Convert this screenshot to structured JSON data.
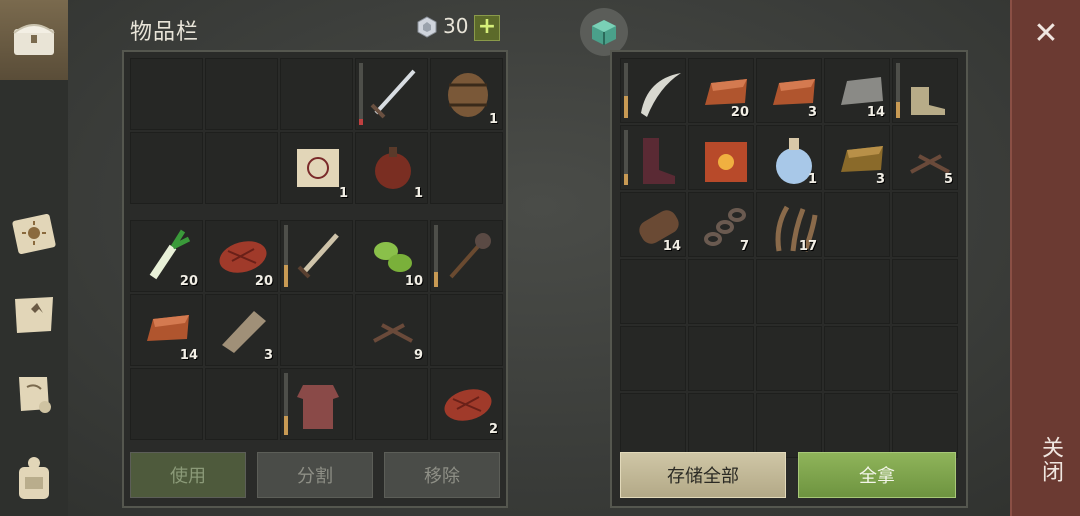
{
  "header": {
    "title": "物品栏",
    "currency": "30",
    "add_label": "+"
  },
  "left_inventory": {
    "equipment_grid": [
      {
        "item": ""
      },
      {
        "item": ""
      },
      {
        "item": ""
      },
      {
        "item": "longsword",
        "count": "",
        "durability": 0.1,
        "bar_color": "red"
      },
      {
        "item": "barrel",
        "count": "1"
      },
      {
        "item": ""
      },
      {
        "item": ""
      },
      {
        "item": "recipe-scroll",
        "count": "1"
      },
      {
        "item": "leather-flask",
        "count": "1"
      },
      {
        "item": ""
      }
    ],
    "backpack_grid": [
      {
        "item": "leek",
        "count": "20"
      },
      {
        "item": "raw-meat",
        "count": "20"
      },
      {
        "item": "sword",
        "count": "",
        "durability": 0.35
      },
      {
        "item": "herb-bundle",
        "count": "10"
      },
      {
        "item": "mace",
        "count": "",
        "durability": 0.25
      },
      {
        "item": "copper-ingot",
        "count": "14"
      },
      {
        "item": "wood-plank",
        "count": "3"
      },
      {
        "item": ""
      },
      {
        "item": "nails",
        "count": "9"
      },
      {
        "item": ""
      },
      {
        "item": ""
      },
      {
        "item": ""
      },
      {
        "item": "chainmail",
        "count": "",
        "durability": 0.3
      },
      {
        "item": ""
      },
      {
        "item": "raw-meat",
        "count": "2"
      }
    ],
    "buttons": {
      "use": "使用",
      "split": "分割",
      "remove": "移除"
    }
  },
  "container": {
    "grid": [
      {
        "item": "scimitar",
        "count": "",
        "durability": 0.4
      },
      {
        "item": "copper-ingot",
        "count": "20"
      },
      {
        "item": "copper-ingot",
        "count": "3"
      },
      {
        "item": "stone",
        "count": "14"
      },
      {
        "item": "boots",
        "count": "",
        "durability": 0.3
      },
      {
        "item": "leather-boots",
        "count": "",
        "durability": 0.2
      },
      {
        "item": "sun-book",
        "count": ""
      },
      {
        "item": "frost-potion",
        "count": "1"
      },
      {
        "item": "bronze-ingot",
        "count": "3"
      },
      {
        "item": "nails",
        "count": "5"
      },
      {
        "item": "log",
        "count": "14"
      },
      {
        "item": "chain",
        "count": "7"
      },
      {
        "item": "fiber",
        "count": "17"
      },
      {
        "item": ""
      },
      {
        "item": ""
      },
      {
        "item": ""
      },
      {
        "item": ""
      },
      {
        "item": ""
      },
      {
        "item": ""
      },
      {
        "item": ""
      },
      {
        "item": ""
      },
      {
        "item": ""
      },
      {
        "item": ""
      },
      {
        "item": ""
      },
      {
        "item": ""
      },
      {
        "item": ""
      },
      {
        "item": ""
      },
      {
        "item": ""
      },
      {
        "item": ""
      },
      {
        "item": ""
      }
    ],
    "buttons": {
      "store_all": "存储全部",
      "take_all": "全拿"
    }
  },
  "close": {
    "label": "关闭",
    "x": "✕"
  },
  "sidebar": [
    "chest-icon",
    "sun-book-icon",
    "crafting-map-icon",
    "quest-scroll-icon",
    "backpack-icon"
  ]
}
